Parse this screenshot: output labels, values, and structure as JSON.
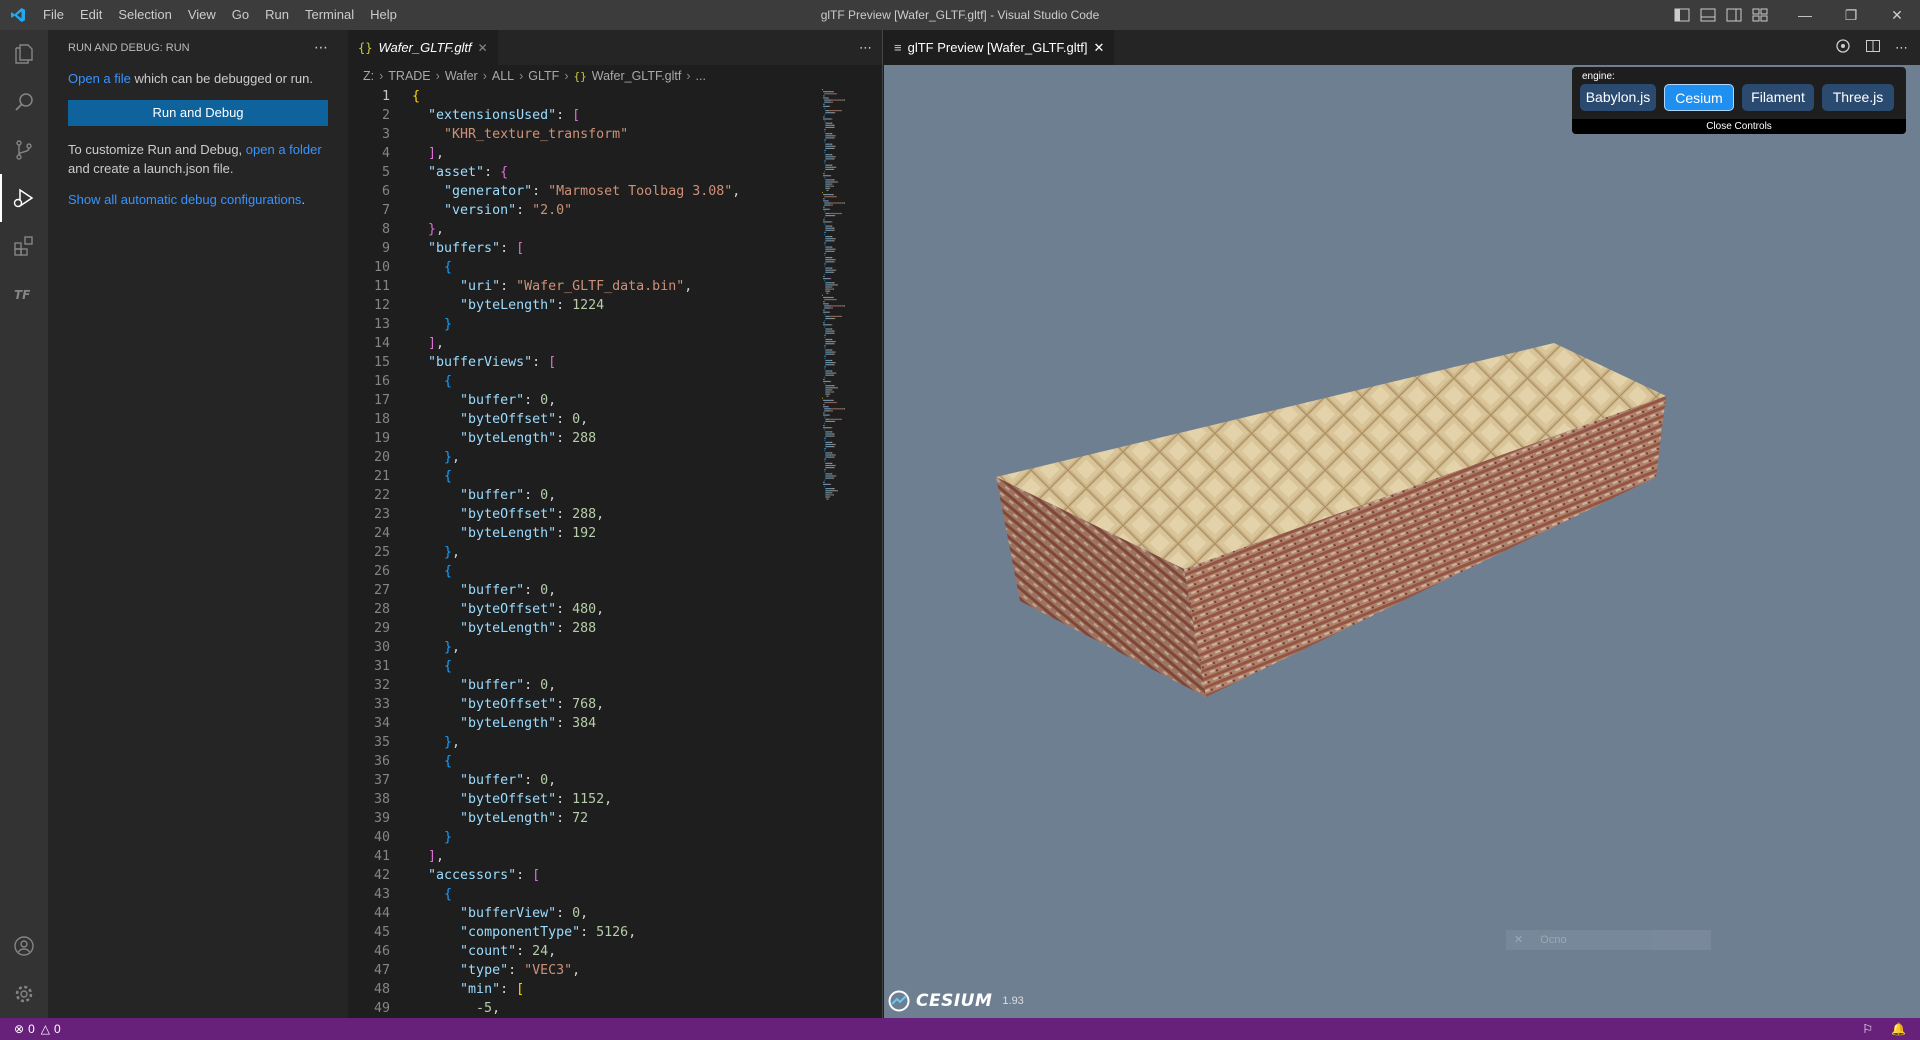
{
  "window": {
    "title": "glTF Preview [Wafer_GLTF.gltf] - Visual Studio Code",
    "menu": [
      "File",
      "Edit",
      "Selection",
      "View",
      "Go",
      "Run",
      "Terminal",
      "Help"
    ]
  },
  "sidebar": {
    "header": "RUN AND DEBUG: RUN",
    "open_file_link": "Open a file",
    "open_file_rest": " which can be debugged or run.",
    "run_button": "Run and Debug",
    "customize_text": "To customize Run and Debug, ",
    "open_folder_link": "open a folder",
    "customize_rest": "and create a launch.json file.",
    "show_configs_link": "Show all automatic debug configurations",
    "show_configs_rest": "."
  },
  "editor": {
    "tab_label": "Wafer_GLTF.gltf",
    "tab_icon": "{}",
    "breadcrumb": [
      "Z:",
      "TRADE",
      "Wafer",
      "ALL",
      "GLTF",
      "Wafer_GLTF.gltf",
      "..."
    ],
    "breadcrumb_file_icon": "{}"
  },
  "preview": {
    "tab_label": "glTF Preview [Wafer_GLTF.gltf]",
    "engine_label": "engine:",
    "engines": [
      "Babylon.js",
      "Cesium",
      "Filament",
      "Three.js"
    ],
    "selected_engine": "Cesium",
    "close_controls": "Close Controls",
    "ghost_input_text": "Ocno",
    "cesium_logo_text": "CESIUM",
    "cesium_version": "1.93",
    "viewport_bg": "#6f7f92"
  },
  "status": {
    "errors": "0",
    "warnings": "0",
    "bar_color": "#68217a"
  },
  "code_lines": [
    [
      [
        "b1",
        "{"
      ]
    ],
    [
      [
        "t",
        "  "
      ],
      [
        "k",
        "\"extensionsUsed\""
      ],
      [
        "t",
        ": "
      ],
      [
        "b2",
        "["
      ]
    ],
    [
      [
        "t",
        "    "
      ],
      [
        "s",
        "\"KHR_texture_transform\""
      ]
    ],
    [
      [
        "t",
        "  "
      ],
      [
        "b2",
        "]"
      ],
      [
        "t",
        ","
      ]
    ],
    [
      [
        "t",
        "  "
      ],
      [
        "k",
        "\"asset\""
      ],
      [
        "t",
        ": "
      ],
      [
        "b2",
        "{"
      ]
    ],
    [
      [
        "t",
        "    "
      ],
      [
        "k",
        "\"generator\""
      ],
      [
        "t",
        ": "
      ],
      [
        "s",
        "\"Marmoset Toolbag 3.08\""
      ],
      [
        "t",
        ","
      ]
    ],
    [
      [
        "t",
        "    "
      ],
      [
        "k",
        "\"version\""
      ],
      [
        "t",
        ": "
      ],
      [
        "s",
        "\"2.0\""
      ]
    ],
    [
      [
        "t",
        "  "
      ],
      [
        "b2",
        "}"
      ],
      [
        "t",
        ","
      ]
    ],
    [
      [
        "t",
        "  "
      ],
      [
        "k",
        "\"buffers\""
      ],
      [
        "t",
        ": "
      ],
      [
        "b2",
        "["
      ]
    ],
    [
      [
        "t",
        "    "
      ],
      [
        "b3",
        "{"
      ]
    ],
    [
      [
        "t",
        "      "
      ],
      [
        "k",
        "\"uri\""
      ],
      [
        "t",
        ": "
      ],
      [
        "s",
        "\"Wafer_GLTF_data.bin\""
      ],
      [
        "t",
        ","
      ]
    ],
    [
      [
        "t",
        "      "
      ],
      [
        "k",
        "\"byteLength\""
      ],
      [
        "t",
        ": "
      ],
      [
        "n",
        "1224"
      ]
    ],
    [
      [
        "t",
        "    "
      ],
      [
        "b3",
        "}"
      ]
    ],
    [
      [
        "t",
        "  "
      ],
      [
        "b2",
        "]"
      ],
      [
        "t",
        ","
      ]
    ],
    [
      [
        "t",
        "  "
      ],
      [
        "k",
        "\"bufferViews\""
      ],
      [
        "t",
        ": "
      ],
      [
        "b2",
        "["
      ]
    ],
    [
      [
        "t",
        "    "
      ],
      [
        "b3",
        "{"
      ]
    ],
    [
      [
        "t",
        "      "
      ],
      [
        "k",
        "\"buffer\""
      ],
      [
        "t",
        ": "
      ],
      [
        "n",
        "0"
      ],
      [
        "t",
        ","
      ]
    ],
    [
      [
        "t",
        "      "
      ],
      [
        "k",
        "\"byteOffset\""
      ],
      [
        "t",
        ": "
      ],
      [
        "n",
        "0"
      ],
      [
        "t",
        ","
      ]
    ],
    [
      [
        "t",
        "      "
      ],
      [
        "k",
        "\"byteLength\""
      ],
      [
        "t",
        ": "
      ],
      [
        "n",
        "288"
      ]
    ],
    [
      [
        "t",
        "    "
      ],
      [
        "b3",
        "}"
      ],
      [
        "t",
        ","
      ]
    ],
    [
      [
        "t",
        "    "
      ],
      [
        "b3",
        "{"
      ]
    ],
    [
      [
        "t",
        "      "
      ],
      [
        "k",
        "\"buffer\""
      ],
      [
        "t",
        ": "
      ],
      [
        "n",
        "0"
      ],
      [
        "t",
        ","
      ]
    ],
    [
      [
        "t",
        "      "
      ],
      [
        "k",
        "\"byteOffset\""
      ],
      [
        "t",
        ": "
      ],
      [
        "n",
        "288"
      ],
      [
        "t",
        ","
      ]
    ],
    [
      [
        "t",
        "      "
      ],
      [
        "k",
        "\"byteLength\""
      ],
      [
        "t",
        ": "
      ],
      [
        "n",
        "192"
      ]
    ],
    [
      [
        "t",
        "    "
      ],
      [
        "b3",
        "}"
      ],
      [
        "t",
        ","
      ]
    ],
    [
      [
        "t",
        "    "
      ],
      [
        "b3",
        "{"
      ]
    ],
    [
      [
        "t",
        "      "
      ],
      [
        "k",
        "\"buffer\""
      ],
      [
        "t",
        ": "
      ],
      [
        "n",
        "0"
      ],
      [
        "t",
        ","
      ]
    ],
    [
      [
        "t",
        "      "
      ],
      [
        "k",
        "\"byteOffset\""
      ],
      [
        "t",
        ": "
      ],
      [
        "n",
        "480"
      ],
      [
        "t",
        ","
      ]
    ],
    [
      [
        "t",
        "      "
      ],
      [
        "k",
        "\"byteLength\""
      ],
      [
        "t",
        ": "
      ],
      [
        "n",
        "288"
      ]
    ],
    [
      [
        "t",
        "    "
      ],
      [
        "b3",
        "}"
      ],
      [
        "t",
        ","
      ]
    ],
    [
      [
        "t",
        "    "
      ],
      [
        "b3",
        "{"
      ]
    ],
    [
      [
        "t",
        "      "
      ],
      [
        "k",
        "\"buffer\""
      ],
      [
        "t",
        ": "
      ],
      [
        "n",
        "0"
      ],
      [
        "t",
        ","
      ]
    ],
    [
      [
        "t",
        "      "
      ],
      [
        "k",
        "\"byteOffset\""
      ],
      [
        "t",
        ": "
      ],
      [
        "n",
        "768"
      ],
      [
        "t",
        ","
      ]
    ],
    [
      [
        "t",
        "      "
      ],
      [
        "k",
        "\"byteLength\""
      ],
      [
        "t",
        ": "
      ],
      [
        "n",
        "384"
      ]
    ],
    [
      [
        "t",
        "    "
      ],
      [
        "b3",
        "}"
      ],
      [
        "t",
        ","
      ]
    ],
    [
      [
        "t",
        "    "
      ],
      [
        "b3",
        "{"
      ]
    ],
    [
      [
        "t",
        "      "
      ],
      [
        "k",
        "\"buffer\""
      ],
      [
        "t",
        ": "
      ],
      [
        "n",
        "0"
      ],
      [
        "t",
        ","
      ]
    ],
    [
      [
        "t",
        "      "
      ],
      [
        "k",
        "\"byteOffset\""
      ],
      [
        "t",
        ": "
      ],
      [
        "n",
        "1152"
      ],
      [
        "t",
        ","
      ]
    ],
    [
      [
        "t",
        "      "
      ],
      [
        "k",
        "\"byteLength\""
      ],
      [
        "t",
        ": "
      ],
      [
        "n",
        "72"
      ]
    ],
    [
      [
        "t",
        "    "
      ],
      [
        "b3",
        "}"
      ]
    ],
    [
      [
        "t",
        "  "
      ],
      [
        "b2",
        "]"
      ],
      [
        "t",
        ","
      ]
    ],
    [
      [
        "t",
        "  "
      ],
      [
        "k",
        "\"accessors\""
      ],
      [
        "t",
        ": "
      ],
      [
        "b2",
        "["
      ]
    ],
    [
      [
        "t",
        "    "
      ],
      [
        "b3",
        "{"
      ]
    ],
    [
      [
        "t",
        "      "
      ],
      [
        "k",
        "\"bufferView\""
      ],
      [
        "t",
        ": "
      ],
      [
        "n",
        "0"
      ],
      [
        "t",
        ","
      ]
    ],
    [
      [
        "t",
        "      "
      ],
      [
        "k",
        "\"componentType\""
      ],
      [
        "t",
        ": "
      ],
      [
        "n",
        "5126"
      ],
      [
        "t",
        ","
      ]
    ],
    [
      [
        "t",
        "      "
      ],
      [
        "k",
        "\"count\""
      ],
      [
        "t",
        ": "
      ],
      [
        "n",
        "24"
      ],
      [
        "t",
        ","
      ]
    ],
    [
      [
        "t",
        "      "
      ],
      [
        "k",
        "\"type\""
      ],
      [
        "t",
        ": "
      ],
      [
        "s",
        "\"VEC3\""
      ],
      [
        "t",
        ","
      ]
    ],
    [
      [
        "t",
        "      "
      ],
      [
        "k",
        "\"min\""
      ],
      [
        "t",
        ": "
      ],
      [
        "b1",
        "["
      ]
    ],
    [
      [
        "t",
        "        "
      ],
      [
        "n",
        "-5"
      ],
      [
        "t",
        ","
      ]
    ]
  ]
}
